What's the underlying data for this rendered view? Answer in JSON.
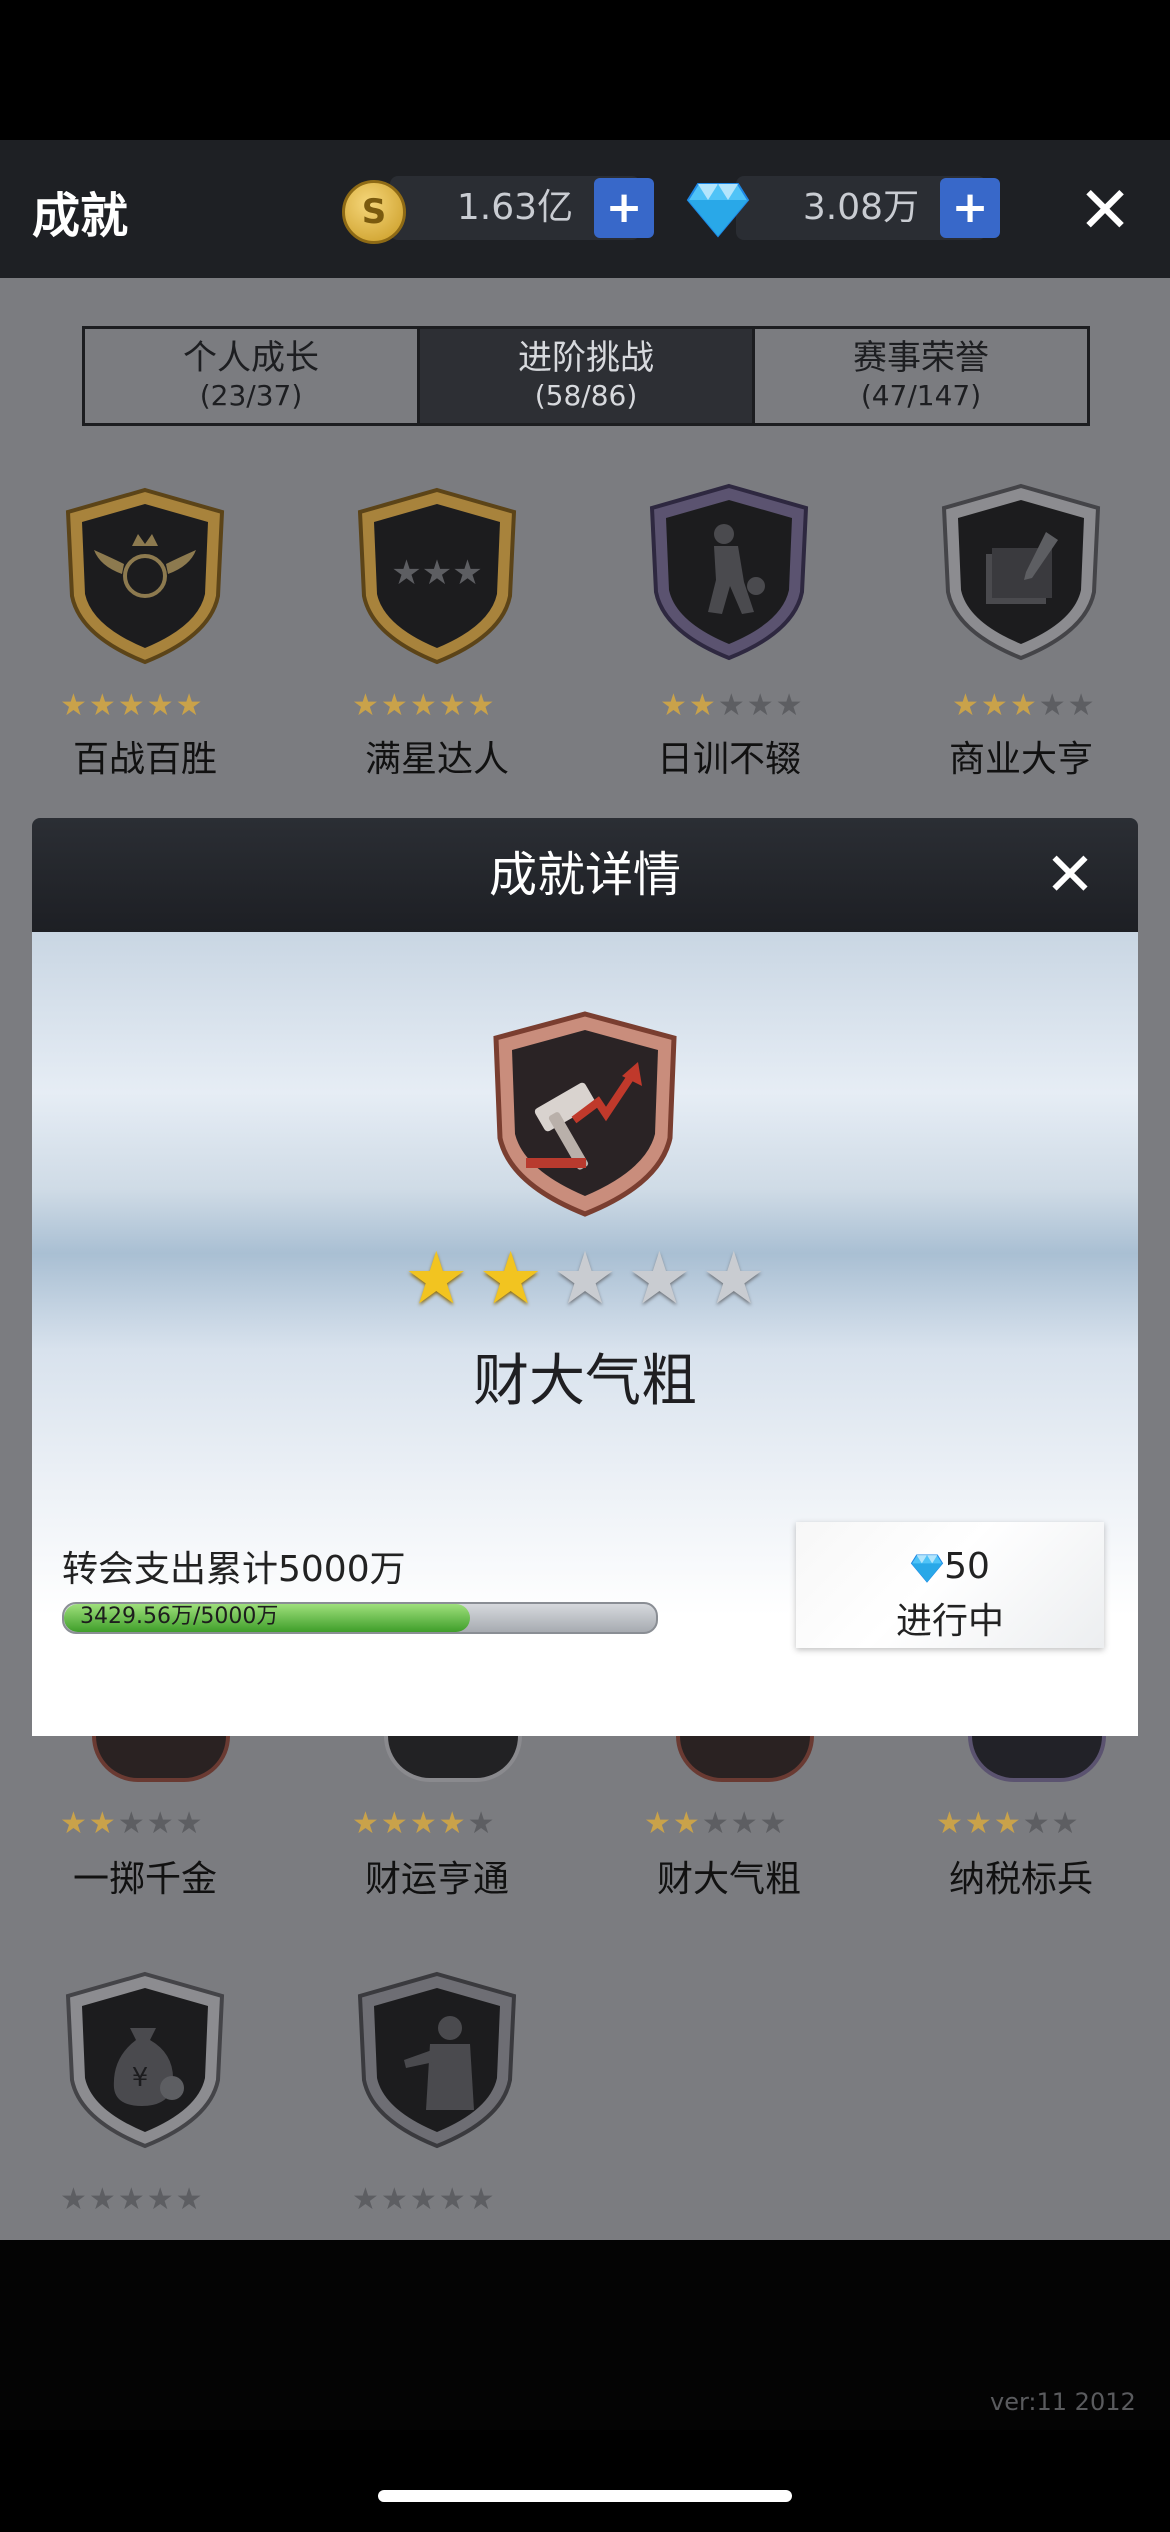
{
  "header": {
    "title": "成就",
    "coins": "1.63亿",
    "diamonds": "3.08万",
    "plus_label": "+",
    "close_label": "✕"
  },
  "tabs": [
    {
      "label": "个人成长",
      "count": "(23/37)",
      "active": false
    },
    {
      "label": "进阶挑战",
      "count": "(58/86)",
      "active": true
    },
    {
      "label": "赛事荣誉",
      "count": "(47/147)",
      "active": false
    }
  ],
  "achievements_row1": [
    {
      "name": "百战百胜",
      "stars": 5,
      "icon": "winged-basketball-icon"
    },
    {
      "name": "满星达人",
      "stars": 5,
      "icon": "three-stars-icon"
    },
    {
      "name": "日训不辍",
      "stars": 2,
      "icon": "dribbling-player-icon"
    },
    {
      "name": "商业大亨",
      "stars": 3,
      "icon": "documents-pen-icon"
    }
  ],
  "achievements_row2": [
    {
      "name": "一掷千金",
      "stars": 2
    },
    {
      "name": "财运亨通",
      "stars": 4
    },
    {
      "name": "财大气粗",
      "stars": 2
    },
    {
      "name": "纳税标兵",
      "stars": 3
    }
  ],
  "achievements_row3": [
    {
      "name": "",
      "stars": 0,
      "icon": "money-bag-icon"
    },
    {
      "name": "",
      "stars": 0,
      "icon": "businessman-icon"
    }
  ],
  "version": "ver:11  2012",
  "modal": {
    "title": "成就详情",
    "close_label": "✕",
    "achievement_name": "财大气粗",
    "stars_filled": 2,
    "stars_total": 5,
    "icon": "gavel-rising-arrow-icon",
    "task": "转会支出累计5000万",
    "progress_text": "3429.56万/5000万",
    "progress_fraction": 0.6859,
    "reward_amount": "50",
    "reward_status": "进行中"
  },
  "colors": {
    "accent_blue": "#3868c9",
    "star_gold": "#f2c420",
    "progress_green": "#4caf2f"
  }
}
